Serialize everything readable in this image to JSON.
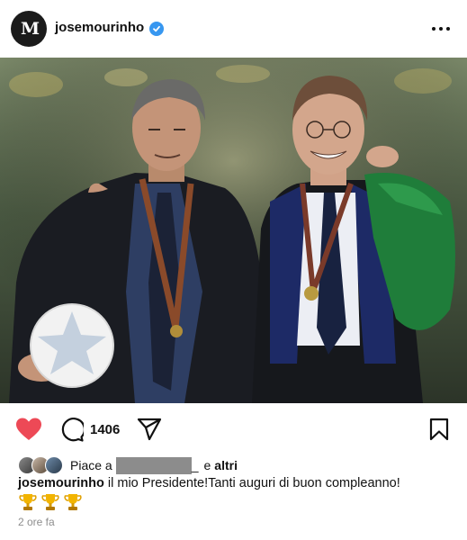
{
  "post": {
    "username": "josemourinho",
    "avatar_initials": "M",
    "verified": true,
    "more_icon": "ellipsis-horizontal-icon"
  },
  "actions": {
    "like_icon": "heart-filled-icon",
    "like_color": "#ed4956",
    "comment_icon": "comment-bubble-icon",
    "comment_count": "1406",
    "share_icon": "paper-plane-icon",
    "save_icon": "bookmark-icon"
  },
  "likes": {
    "prefix": "Piace a",
    "redacted_suffix": "_",
    "separator": "e",
    "others": "altri"
  },
  "caption": {
    "username": "josemourinho",
    "text": "il mio Presidente!Tanti auguri di buon compleanno!",
    "emoji_line": "🏆🏆🏆"
  },
  "timestamp": "2 ore fa",
  "colors": {
    "verified_badge": "#3797f0",
    "text": "#111111",
    "muted": "#8e8e8e"
  }
}
